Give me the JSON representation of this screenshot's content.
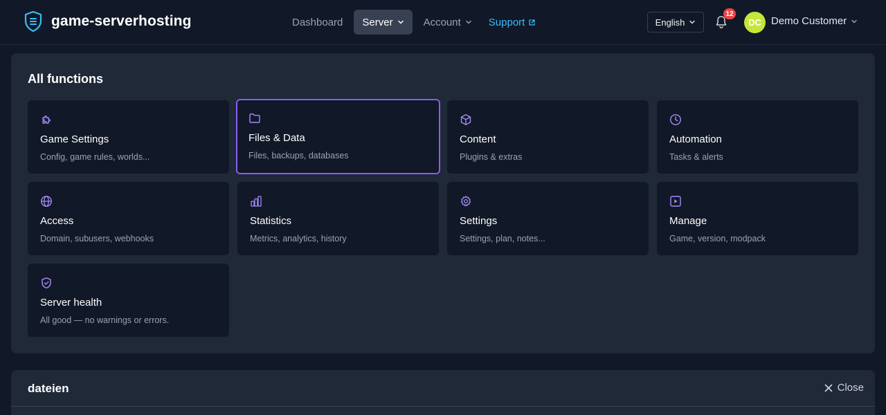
{
  "brand": {
    "name": "game-serverhosting",
    "icon": "shield-server-icon"
  },
  "nav": {
    "dashboard": "Dashboard",
    "server": "Server",
    "account": "Account",
    "support": "Support"
  },
  "header": {
    "language": "English",
    "notifications_count": "12",
    "avatar_initials": "DC",
    "user_name": "Demo Customer"
  },
  "colors": {
    "accent": "#8b5cf6",
    "support_link": "#38bdf8",
    "badge": "#ef4444",
    "avatar": "#c6e53a"
  },
  "functions": {
    "title": "All functions",
    "tiles": [
      {
        "title": "Game Settings",
        "subtitle": "Config, game rules, worlds...",
        "icon": "puzzle-icon"
      },
      {
        "title": "Files & Data",
        "subtitle": "Files, backups, databases",
        "icon": "folder-icon",
        "selected": true
      },
      {
        "title": "Content",
        "subtitle": "Plugins & extras",
        "icon": "box-icon"
      },
      {
        "title": "Automation",
        "subtitle": "Tasks & alerts",
        "icon": "clock-icon"
      },
      {
        "title": "Access",
        "subtitle": "Domain, subusers, webhooks",
        "icon": "globe-icon"
      },
      {
        "title": "Statistics",
        "subtitle": "Metrics, analytics, history",
        "icon": "bar-chart-icon"
      },
      {
        "title": "Settings",
        "subtitle": "Settings, plan, notes...",
        "icon": "gear-icon"
      },
      {
        "title": "Manage",
        "subtitle": "Game, version, modpack",
        "icon": "play-square-icon"
      },
      {
        "title": "Server health",
        "subtitle": "All good — no warnings or errors.",
        "icon": "shield-check-icon"
      }
    ]
  },
  "files_panel": {
    "title": "dateien",
    "close_label": "Close"
  }
}
